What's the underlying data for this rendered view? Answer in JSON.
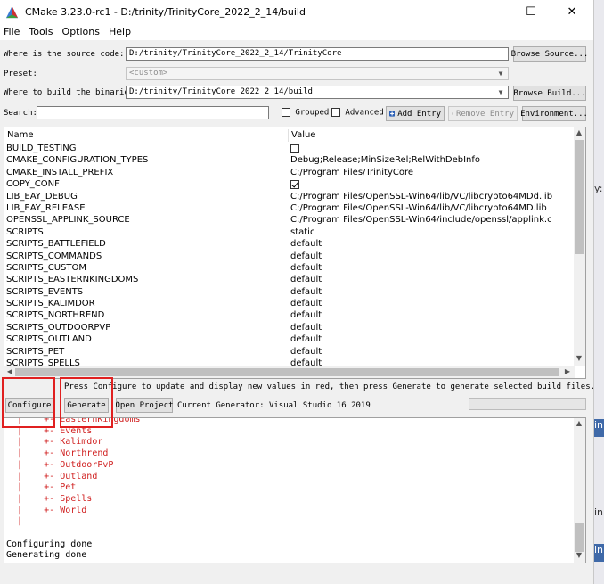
{
  "window": {
    "title": "CMake 3.23.0-rc1 - D:/trinity/TrinityCore_2022_2_14/build",
    "minimize_glyph": "—",
    "maximize_glyph": "☐",
    "close_glyph": "✕"
  },
  "menu": [
    "File",
    "Tools",
    "Options",
    "Help"
  ],
  "source": {
    "label": "Where is the source code:",
    "value": "D:/trinity/TrinityCore_2022_2_14/TrinityCore",
    "browse_label": "Browse Source..."
  },
  "preset": {
    "label": "Preset:",
    "value": "<custom>"
  },
  "build": {
    "label": "Where to build the binaries:",
    "value": "D:/trinity/TrinityCore_2022_2_14/build",
    "browse_label": "Browse Build..."
  },
  "search": {
    "label": "Search:",
    "value": "",
    "grouped_label": "Grouped",
    "advanced_label": "Advanced",
    "add_entry_label": "Add Entry",
    "remove_entry_label": "Remove Entry",
    "environment_label": "Environment..."
  },
  "table": {
    "col_name": "Name",
    "col_value": "Value",
    "rows": [
      {
        "name": "BUILD_TESTING",
        "value": "",
        "checkbox": "unchecked"
      },
      {
        "name": "CMAKE_CONFIGURATION_TYPES",
        "value": "Debug;Release;MinSizeRel;RelWithDebInfo"
      },
      {
        "name": "CMAKE_INSTALL_PREFIX",
        "value": "C:/Program Files/TrinityCore"
      },
      {
        "name": "COPY_CONF",
        "value": "",
        "checkbox": "checked"
      },
      {
        "name": "LIB_EAY_DEBUG",
        "value": "C:/Program Files/OpenSSL-Win64/lib/VC/libcrypto64MDd.lib"
      },
      {
        "name": "LIB_EAY_RELEASE",
        "value": "C:/Program Files/OpenSSL-Win64/lib/VC/libcrypto64MD.lib"
      },
      {
        "name": "OPENSSL_APPLINK_SOURCE",
        "value": "C:/Program Files/OpenSSL-Win64/include/openssl/applink.c"
      },
      {
        "name": "SCRIPTS",
        "value": "static"
      },
      {
        "name": "SCRIPTS_BATTLEFIELD",
        "value": "default"
      },
      {
        "name": "SCRIPTS_COMMANDS",
        "value": "default"
      },
      {
        "name": "SCRIPTS_CUSTOM",
        "value": "default"
      },
      {
        "name": "SCRIPTS_EASTERNKINGDOMS",
        "value": "default"
      },
      {
        "name": "SCRIPTS_EVENTS",
        "value": "default"
      },
      {
        "name": "SCRIPTS_KALIMDOR",
        "value": "default"
      },
      {
        "name": "SCRIPTS_NORTHREND",
        "value": "default"
      },
      {
        "name": "SCRIPTS_OUTDOORPVP",
        "value": "default"
      },
      {
        "name": "SCRIPTS_OUTLAND",
        "value": "default"
      },
      {
        "name": "SCRIPTS_PET",
        "value": "default"
      },
      {
        "name": "SCRIPTS_SPELLS",
        "value": "default"
      }
    ]
  },
  "status_text": "Press Configure to update and display new values in red, then press Generate to generate selected build files.",
  "actions": {
    "configure_label": "Configure",
    "generate_label": "Generate",
    "open_project_label": "Open Project",
    "generator_text": "Current Generator: Visual Studio 16 2019"
  },
  "output": {
    "tree_lines": [
      "  |    +- EasternKingdoms",
      "  |    +- Events",
      "  |    +- Kalimdor",
      "  |    +- Northrend",
      "  |    +- OutdoorPvP",
      "  |    +- Outland",
      "  |    +- Pet",
      "  |    +- Spells",
      "  |    +- World",
      "  |"
    ],
    "done_lines": [
      "Configuring done",
      "Generating done"
    ]
  },
  "colors": {
    "accent_red": "#d02020",
    "highlight_red": "#e02020"
  }
}
